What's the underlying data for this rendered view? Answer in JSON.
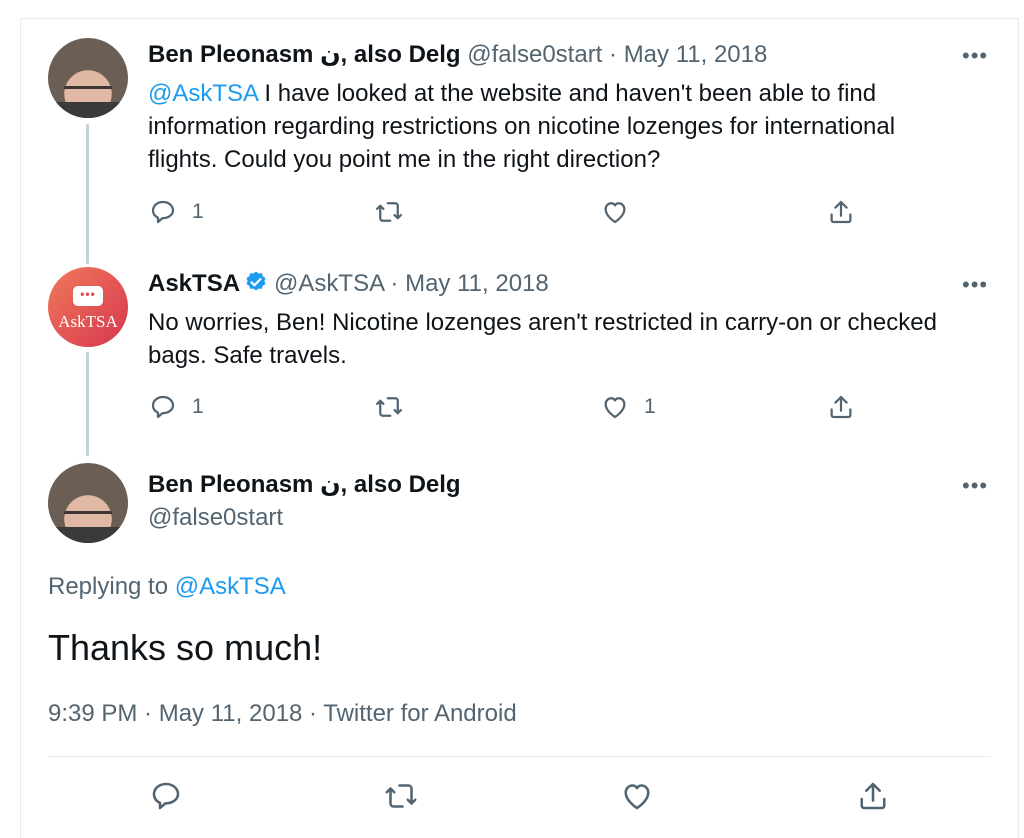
{
  "tweets": [
    {
      "name": "Ben Pleonasm ن, also Delg",
      "handle": "@false0start",
      "date": "May 11, 2018",
      "mention": "@AskTSA",
      "text": " I have looked at the website and haven't been able to find information regarding restrictions on nicotine lozenges for international flights. Could you point me in the right direction?",
      "reply_count": "1",
      "like_count": ""
    },
    {
      "name": "AskTSA",
      "handle": "@AskTSA",
      "date": "May 11, 2018",
      "text": "No worries, Ben! Nicotine lozenges aren't restricted in carry-on or checked bags. Safe travels.",
      "reply_count": "1",
      "like_count": "1",
      "avatar_text": "AskTSA"
    }
  ],
  "main_tweet": {
    "name": "Ben Pleonasm ن, also Delg",
    "handle": "@false0start",
    "replying_prefix": "Replying to ",
    "replying_to": "@AskTSA",
    "text": "Thanks so much!",
    "meta": "9:39 PM · May 11, 2018 · Twitter for Android"
  },
  "separator": " · ",
  "more_glyph": "•••",
  "icons": [
    "reply-icon",
    "retweet-icon",
    "like-icon",
    "share-icon",
    "more-icon",
    "verified-badge-icon"
  ],
  "colors": {
    "link": "#1d9bf0",
    "secondary": "#536471",
    "text": "#0f1419",
    "verified": "#1d9bf0"
  }
}
